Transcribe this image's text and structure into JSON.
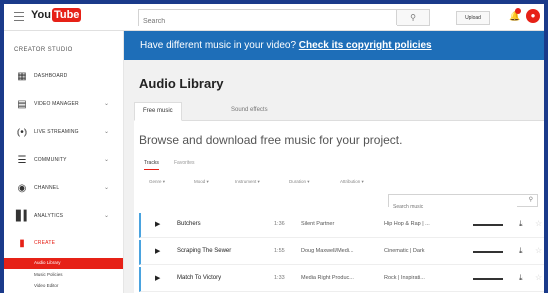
{
  "topbar": {
    "logo_you": "You",
    "logo_tube": "Tube",
    "search_placeholder": "Search",
    "upload_label": "Upload"
  },
  "sidebar": {
    "title": "CREATOR STUDIO",
    "items": [
      {
        "label": "DASHBOARD",
        "icon": "dashboard-icon",
        "chevron": false
      },
      {
        "label": "VIDEO MANAGER",
        "icon": "video-manager-icon",
        "chevron": true
      },
      {
        "label": "LIVE STREAMING",
        "icon": "live-streaming-icon",
        "chevron": true
      },
      {
        "label": "COMMUNITY",
        "icon": "community-icon",
        "chevron": true
      },
      {
        "label": "CHANNEL",
        "icon": "channel-icon",
        "chevron": true
      },
      {
        "label": "ANALYTICS",
        "icon": "analytics-icon",
        "chevron": true
      },
      {
        "label": "CREATE",
        "icon": "create-icon",
        "chevron": false
      }
    ],
    "sub_items": [
      "Audio Library",
      "Music Policies",
      "Video Editor"
    ]
  },
  "banner": {
    "text": "Have different music in your video?",
    "link": "Check its copyright policies"
  },
  "page": {
    "title": "Audio Library",
    "tabs": [
      "Free music",
      "Sound effects"
    ],
    "browse_text": "Browse and download free music for your project.",
    "subtabs": [
      "Tracks",
      "Favorites"
    ],
    "filters": [
      "Genre",
      "Mood",
      "Instrument",
      "Duration",
      "Attribution"
    ],
    "search_placeholder": "Search music"
  },
  "tracks": [
    {
      "title": "Butchers",
      "duration": "1:36",
      "artist": "Silent Partner",
      "genre": "Hip Hop & Rap | ..."
    },
    {
      "title": "Scraping The Sewer",
      "duration": "1:55",
      "artist": "Doug Maxwell/Medi...",
      "genre": "Cinematic | Dark"
    },
    {
      "title": "Match To Victory",
      "duration": "1:33",
      "artist": "Media Right Produc...",
      "genre": "Rock | Inspirati..."
    }
  ],
  "colors": {
    "accent": "#e62117",
    "banner": "#1e6eb8",
    "track_marker": "#4aa3df"
  }
}
